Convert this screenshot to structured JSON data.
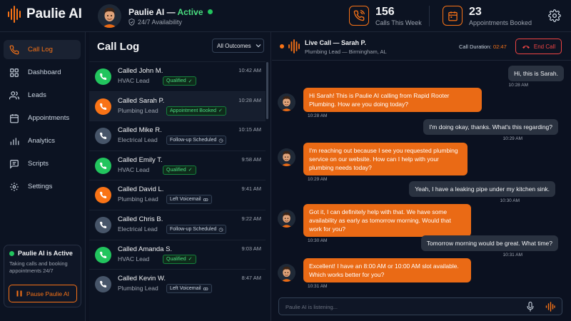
{
  "app": {
    "name": "Paulie AI"
  },
  "header": {
    "agent_name": "Paulie AI —",
    "agent_status": "Active",
    "agent_sub": "24/7 Availability",
    "stats": [
      {
        "value": "156",
        "label": "Calls This Week",
        "icon": "phone-icon"
      },
      {
        "value": "23",
        "label": "Appointments Booked",
        "icon": "calendar-icon"
      }
    ]
  },
  "sidebar": {
    "items": [
      {
        "label": "Call Log",
        "icon": "phone-icon",
        "active": true
      },
      {
        "label": "Dashboard",
        "icon": "grid-icon"
      },
      {
        "label": "Leads",
        "icon": "users-icon"
      },
      {
        "label": "Appointments",
        "icon": "calendar-icon"
      },
      {
        "label": "Analytics",
        "icon": "bar-chart-icon"
      },
      {
        "label": "Scripts",
        "icon": "chat-icon"
      },
      {
        "label": "Settings",
        "icon": "gear-icon"
      }
    ],
    "status_card": {
      "title": "Paulie AI is Active",
      "description": "Taking calls and booking appointments 24/7",
      "button": "Pause Paulie AI"
    }
  },
  "call_log": {
    "title": "Call Log",
    "filter": "All Outcomes",
    "rows": [
      {
        "name": "Called John M.",
        "type": "HVAC Lead",
        "time": "10:42 AM",
        "badge": "Qualified",
        "badge_kind": "green",
        "badge_icon": "✓",
        "icon_color": "#22c55e"
      },
      {
        "name": "Called Sarah P.",
        "type": "Plumbing Lead",
        "time": "10:28 AM",
        "badge": "Appointment Booked",
        "badge_kind": "green",
        "badge_icon": "✓",
        "icon_color": "#f97316"
      },
      {
        "name": "Called Mike R.",
        "type": "Electrical Lead",
        "time": "10:15 AM",
        "badge": "Follow-up Scheduled",
        "badge_kind": "blue",
        "badge_icon": "◷",
        "icon_color": "#475569"
      },
      {
        "name": "Called Emily T.",
        "type": "HVAC Lead",
        "time": "9:58 AM",
        "badge": "Qualified",
        "badge_kind": "green",
        "badge_icon": "✓",
        "icon_color": "#22c55e"
      },
      {
        "name": "Called David L.",
        "type": "Plumbing Lead",
        "time": "9:41 AM",
        "badge": "Left Voicemail",
        "badge_kind": "blue",
        "badge_icon": "ꝏ",
        "icon_color": "#f97316"
      },
      {
        "name": "Called Chris B.",
        "type": "Electrical Lead",
        "time": "9:22 AM",
        "badge": "Follow-up Scheduled",
        "badge_kind": "blue",
        "badge_icon": "◷",
        "icon_color": "#475569"
      },
      {
        "name": "Called Amanda S.",
        "type": "HVAC Lead",
        "time": "9:03 AM",
        "badge": "Qualified",
        "badge_kind": "green",
        "badge_icon": "✓",
        "icon_color": "#22c55e"
      },
      {
        "name": "Called Kevin W.",
        "type": "Plumbing Lead",
        "time": "8:47 AM",
        "badge": "Left Voicemail",
        "badge_kind": "blue",
        "badge_icon": "ꝏ",
        "icon_color": "#475569"
      }
    ]
  },
  "live_call": {
    "title": "Live Call — Sarah P.",
    "subtitle": "Plumbing Lead — Birmingham, AL",
    "duration_label": "Call Duration:",
    "duration": "02:47",
    "end_button": "End Call",
    "messages": [
      {
        "from": "user",
        "text": "Hi, this is Sarah.",
        "time": "10:28 AM"
      },
      {
        "from": "ai",
        "text": "Hi Sarah! This is Paulie AI calling from Rapid Rooter Plumbing. How are you doing today?",
        "time": "10:28 AM"
      },
      {
        "from": "user",
        "text": "I'm doing okay, thanks. What's this regarding?",
        "time": "10:29 AM"
      },
      {
        "from": "ai",
        "text": "I'm reaching out because I see you requested plumbing service on our website. How can I help with your plumbing needs today?",
        "time": "10:29 AM"
      },
      {
        "from": "user",
        "text": "Yeah, I have a leaking pipe under my kitchen sink.",
        "time": "10:30 AM"
      },
      {
        "from": "ai",
        "text": "Got it, I can definitely help with that. We have some availability as early as tomorrow morning. Would that work for you?",
        "time": "10:30 AM"
      },
      {
        "from": "user",
        "text": "Tomorrow morning would be great. What time?",
        "time": "10:31 AM"
      },
      {
        "from": "ai",
        "text": "Excellent! I have an 8:00 AM or 10:00 AM slot available. Which works better for you?",
        "time": "10:31 AM"
      }
    ],
    "input_placeholder": "Paulie AI is listening..."
  },
  "colors": {
    "accent": "#f97316",
    "active": "#22c55e",
    "danger": "#ef4444",
    "background": "#0b1120"
  }
}
